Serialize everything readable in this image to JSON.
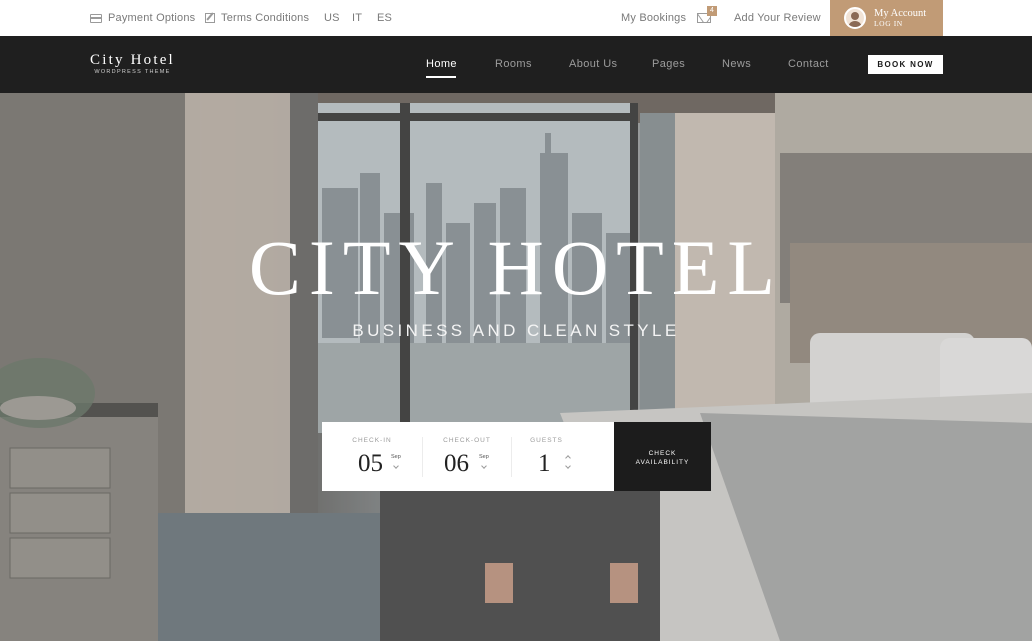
{
  "topbar": {
    "payment_options": "Payment Options",
    "terms_conditions": "Terms Conditions",
    "languages": [
      "US",
      "IT",
      "ES"
    ],
    "my_bookings": "My Bookings",
    "mail_count": "4",
    "add_review": "Add Your Review",
    "account_title": "My Account",
    "account_login": "LOG IN"
  },
  "logo": {
    "name": "City Hotel",
    "subtitle": "WORDPRESS THEME"
  },
  "nav": {
    "items": [
      "Home",
      "Rooms",
      "About Us",
      "Pages",
      "News",
      "Contact"
    ],
    "active": "Home",
    "book_now": "BOOK NOW"
  },
  "hero": {
    "title": "CITY HOTEL",
    "subtitle": "BUSINESS AND CLEAN STYLE"
  },
  "booking": {
    "checkin_label": "CHECK-IN",
    "checkin_day": "05",
    "checkin_month": "Sep",
    "checkout_label": "CHECK-OUT",
    "checkout_day": "06",
    "checkout_month": "Sep",
    "guests_label": "GUESTS",
    "guests_value": "1",
    "check_button_line1": "CHECK",
    "check_button_line2": "AVAILABILITY"
  },
  "colors": {
    "accent": "#c19b76",
    "nav_bg": "#1f1f1f",
    "dark_button": "#1c1c1c"
  },
  "icons": [
    "credit-card-icon",
    "edit-icon",
    "mail-icon",
    "avatar",
    "chevron-up-icon",
    "chevron-down-icon"
  ]
}
